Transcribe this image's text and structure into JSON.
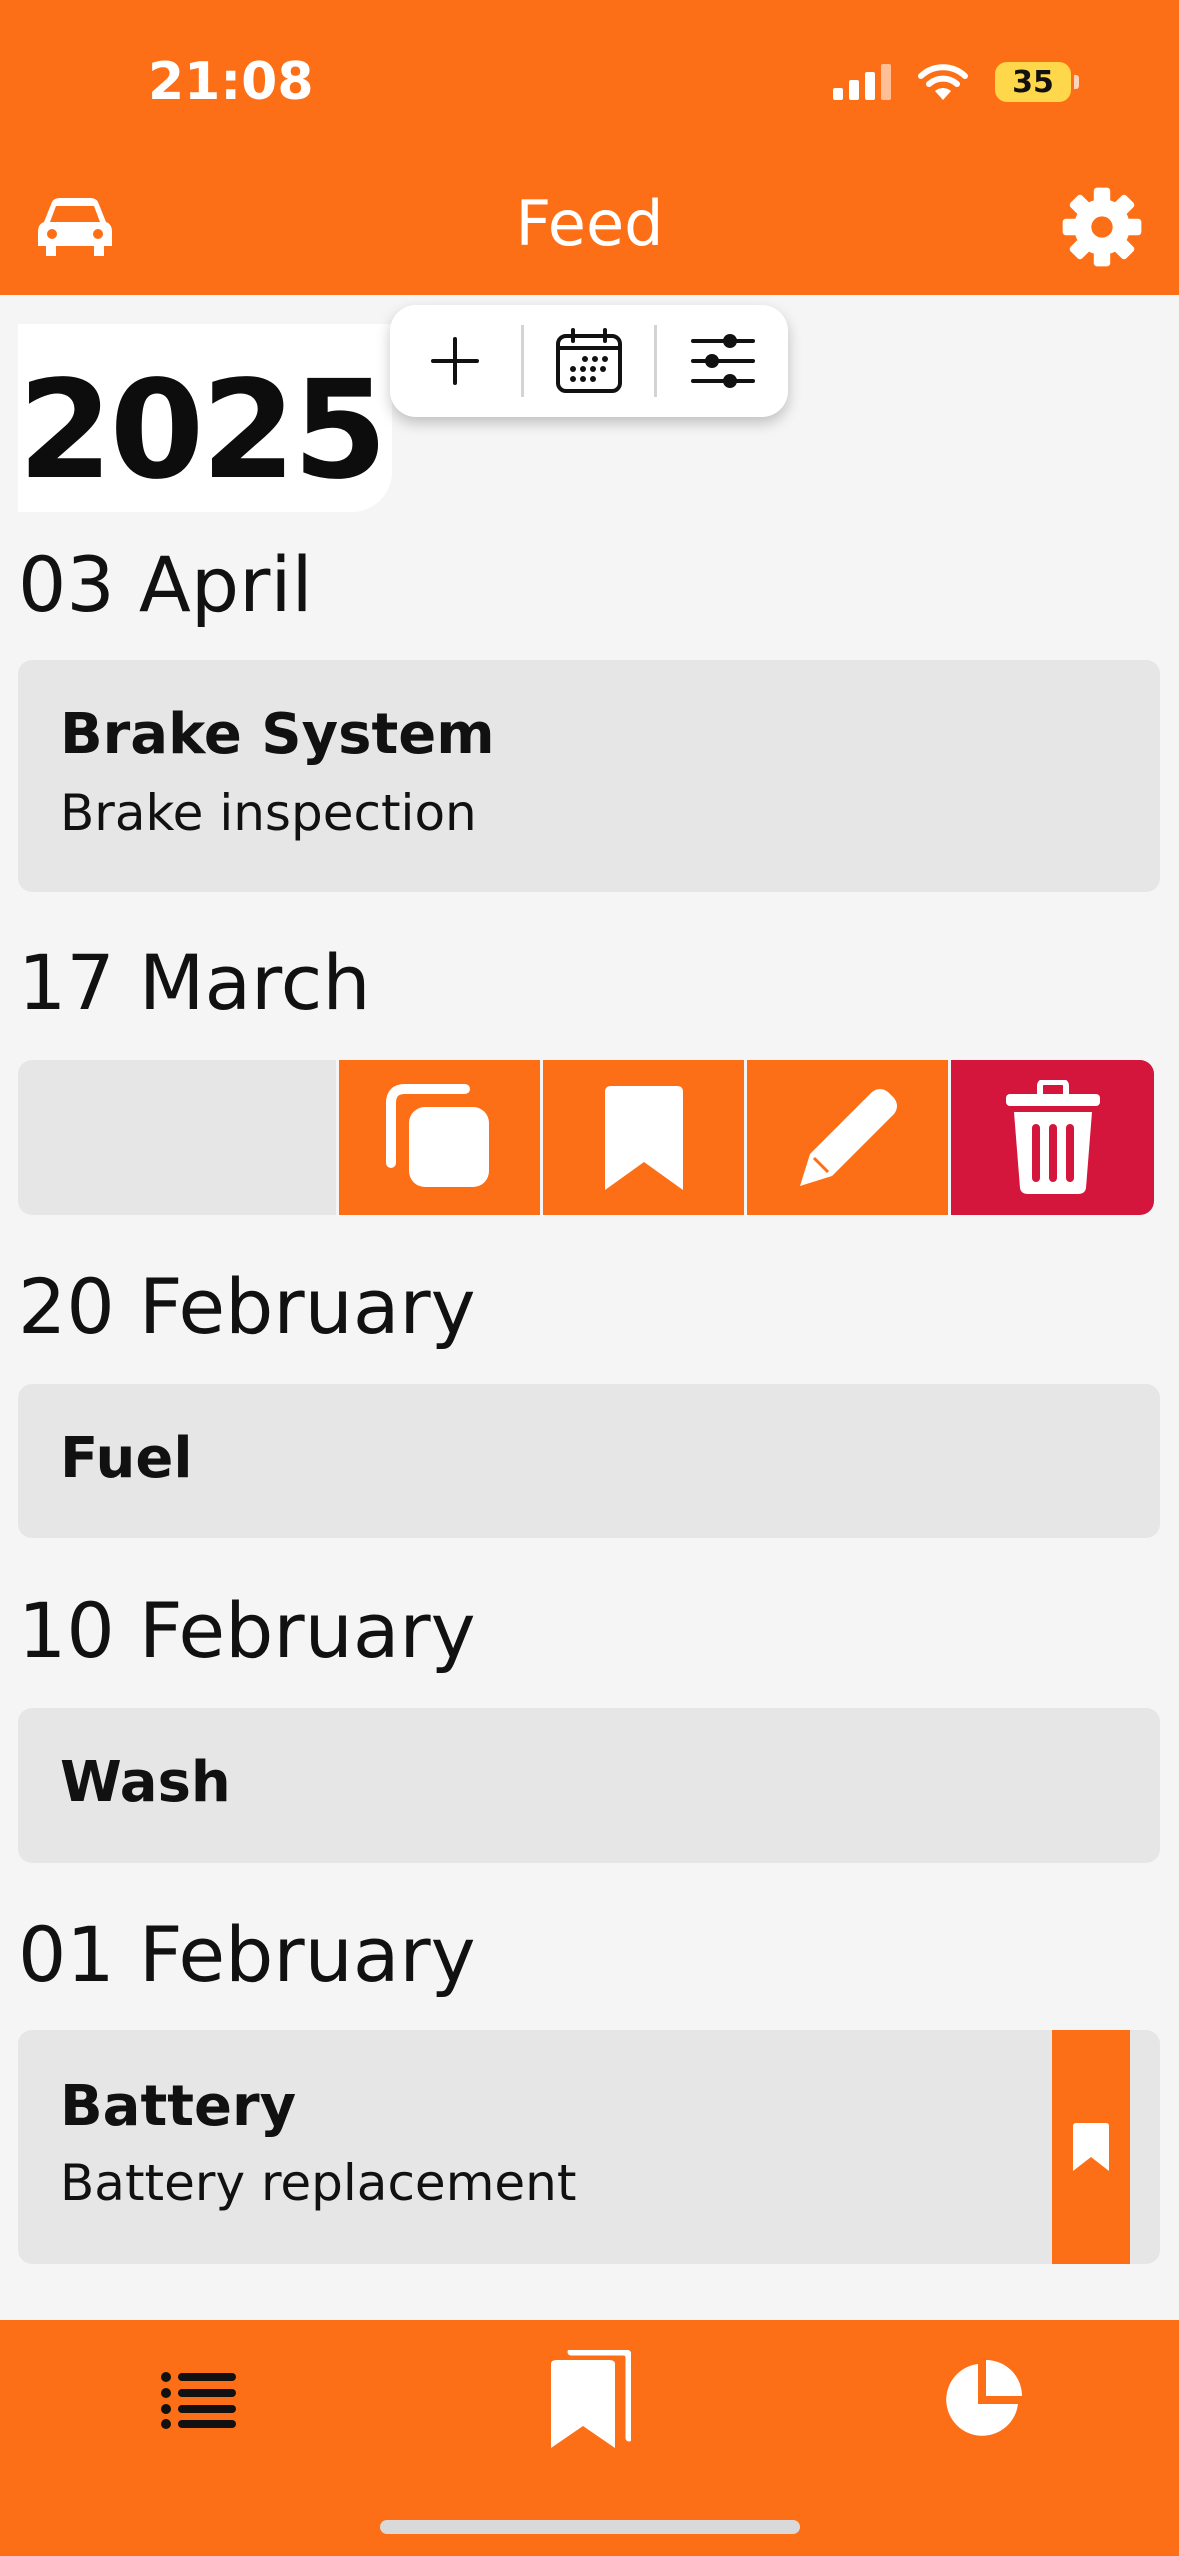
{
  "status_bar": {
    "time": "21:08",
    "battery": "35"
  },
  "header": {
    "title": "Feed",
    "car_icon": "car-icon",
    "settings_icon": "gear-icon"
  },
  "feed": {
    "year": "2025",
    "toolbar": {
      "add_icon": "plus-icon",
      "calendar_icon": "calendar-icon",
      "filter_icon": "sliders-icon"
    },
    "groups": [
      {
        "date": "03 April",
        "title": "Brake System",
        "subtitle": "Brake inspection"
      },
      {
        "date": "17 March",
        "swipe_actions": [
          "copy-icon",
          "bookmark-icon",
          "pencil-icon",
          "trash-icon"
        ]
      },
      {
        "date": "20 February",
        "title": "Fuel"
      },
      {
        "date": "10 February",
        "title": "Wash"
      },
      {
        "date": "01 February",
        "title": "Battery",
        "subtitle": "Battery replacement",
        "bookmarked": true
      }
    ]
  },
  "tab_bar": {
    "tabs": [
      "list-icon",
      "bookmarks-icon",
      "pie-chart-icon"
    ]
  },
  "colors": {
    "accent": "#fd6f17",
    "delete": "#d4153c",
    "card": "#e6e6e6",
    "background": "#f5f5f5"
  }
}
